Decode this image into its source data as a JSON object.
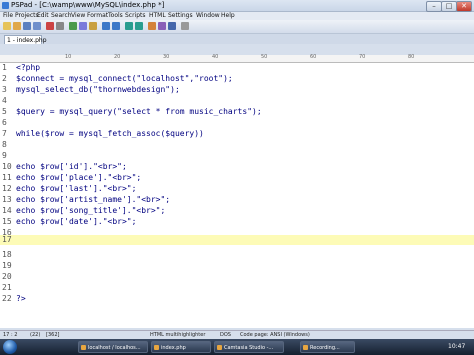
{
  "window": {
    "title": "PSPad - [C:\\wamp\\www\\MySQL\\index.php *]",
    "controls": {
      "minimize": "–",
      "maximize": "□",
      "close": "✕"
    }
  },
  "menu": [
    "File",
    "Projects",
    "Edit",
    "Search",
    "View",
    "Format",
    "Tools",
    "Scripts",
    "HTML",
    "Settings",
    "Window",
    "Help"
  ],
  "tab": {
    "label": "1 - index.php"
  },
  "ruler": [
    "10",
    "20",
    "30",
    "40",
    "50",
    "60",
    "70",
    "80"
  ],
  "editor": {
    "lines": [
      {
        "n": "1",
        "text": "<?php"
      },
      {
        "n": "2",
        "text": "$connect = mysql_connect(\"localhost\",\"root\");"
      },
      {
        "n": "3",
        "text": "mysql_select_db(\"thornwebdesign\");"
      },
      {
        "n": "4",
        "text": ""
      },
      {
        "n": "5",
        "text": "$query = mysql_query(\"select * from music_charts\");"
      },
      {
        "n": "6",
        "text": ""
      },
      {
        "n": "7",
        "text": "while($row = mysql_fetch_assoc($query))"
      },
      {
        "n": "8",
        "text": ""
      },
      {
        "n": "9",
        "text": ""
      },
      {
        "n": "10",
        "text": "echo $row['id'].\"<br>\";"
      },
      {
        "n": "11",
        "text": "echo $row['place'].\"<br>\";"
      },
      {
        "n": "12",
        "text": "echo $row['last'].\"<br>\";"
      },
      {
        "n": "13",
        "text": "echo $row['artist_name'].\"<br>\";"
      },
      {
        "n": "14",
        "text": "echo $row['song_title'].\"<br>\";"
      },
      {
        "n": "15",
        "text": "echo $row['date'].\"<br>\";"
      },
      {
        "n": "16",
        "text": ""
      },
      {
        "n": "17",
        "text": ""
      },
      {
        "n": "18",
        "text": ""
      },
      {
        "n": "19",
        "text": ""
      },
      {
        "n": "20",
        "text": ""
      },
      {
        "n": "21",
        "text": ""
      },
      {
        "n": "22",
        "text": "?>"
      }
    ],
    "current_line": "17"
  },
  "status": {
    "position": "17 : 2",
    "lines": "(22)",
    "size": "[362]",
    "highlighter": "HTML multihighlighter",
    "eol": "DOS",
    "codepage": "Code page: ANSI (Windows)"
  },
  "taskbar": {
    "items": [
      "localhost / localhos...",
      "index.php",
      "Camtasia Studio -...",
      "Recording..."
    ],
    "clock": "10:47"
  },
  "colors": {
    "current_line": "#fdfbb7",
    "code": "#000080",
    "accent": "#3a7bd5"
  }
}
